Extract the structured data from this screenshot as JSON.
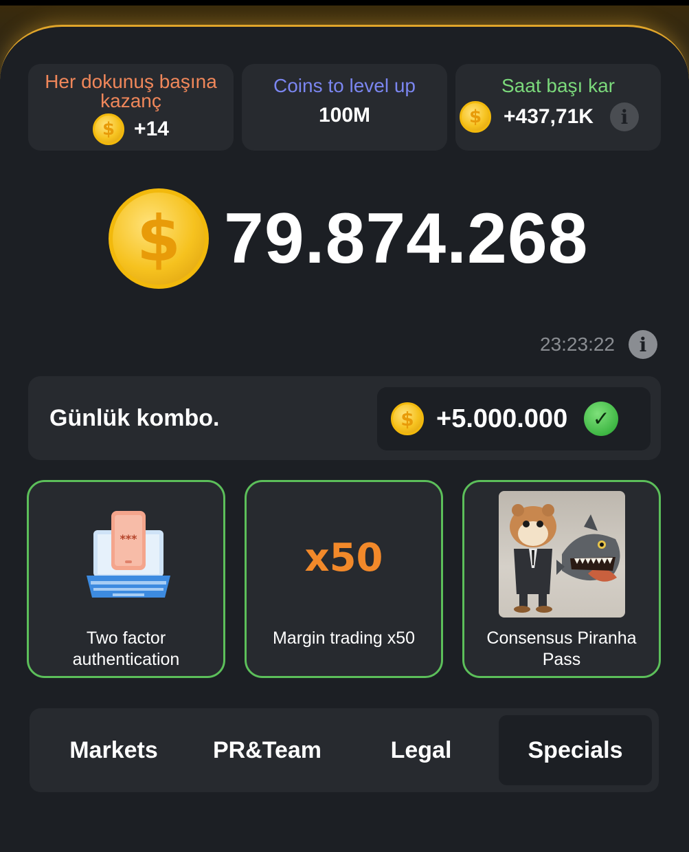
{
  "stats": [
    {
      "title": "Her dokunuş başına kazanç",
      "value": "+14",
      "title_color": "#f0875a",
      "icon": "coin-icon"
    },
    {
      "title": "Coins to level up",
      "value": "100M",
      "title_color": "#7b86f0"
    },
    {
      "title": "Saat başı kar",
      "value": "+437,71K",
      "title_color": "#7bd97b",
      "icon": "coin-icon",
      "info": "info-icon"
    }
  ],
  "balance": "79.874.268",
  "timer": "23:23:22",
  "combo": {
    "label": "Günlük kombo.",
    "reward": "+5.000.000"
  },
  "cards": [
    {
      "label": "Two factor authentication",
      "image": "laptop-phone-icon",
      "phone_text": "***"
    },
    {
      "label": "Margin trading x50",
      "image_text": "x50"
    },
    {
      "label": "Consensus Piranha Pass",
      "image": "hamster-piranha-image"
    }
  ],
  "tabs": [
    {
      "label": "Markets",
      "active": false
    },
    {
      "label": "PR&Team",
      "active": false
    },
    {
      "label": "Legal",
      "active": false
    },
    {
      "label": "Specials",
      "active": true
    }
  ],
  "colors": {
    "accent_gold": "#e0a52a",
    "card_border": "#5cbf5a",
    "x50": "#f2892a"
  }
}
